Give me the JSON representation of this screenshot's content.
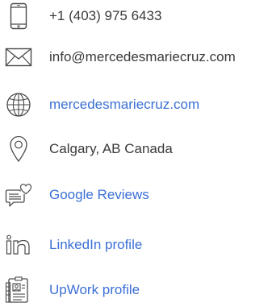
{
  "colors": {
    "text": "#3a3a3a",
    "link": "#3b6fd6",
    "icon": "#4a4a4a"
  },
  "contacts": [
    {
      "icon": "smartphone-icon",
      "text": "+1 (403) 975 6433",
      "is_link": false
    },
    {
      "icon": "envelope-icon",
      "text": "info@mercedesmariecruz.com",
      "is_link": false
    },
    {
      "icon": "globe-icon",
      "text": "mercedesmariecruz.com",
      "is_link": true
    },
    {
      "icon": "map-pin-icon",
      "text": "Calgary, AB  Canada",
      "is_link": false
    },
    {
      "icon": "review-bubble-heart-icon",
      "text": "Google Reviews",
      "is_link": true
    },
    {
      "icon": "linkedin-icon",
      "text": "LinkedIn profile",
      "is_link": true
    },
    {
      "icon": "upwork-profile-icon",
      "text": "UpWork profile",
      "is_link": true
    }
  ]
}
